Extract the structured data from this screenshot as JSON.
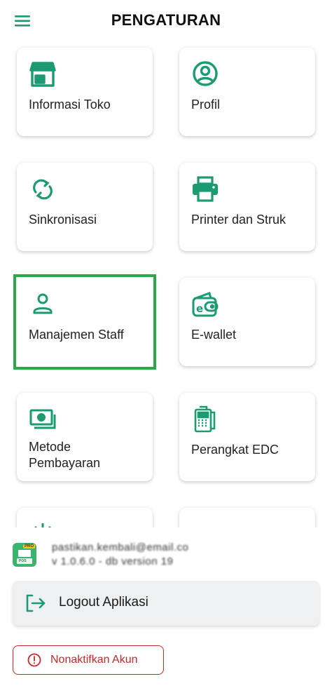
{
  "header": {
    "title": "PENGATURAN",
    "menu_icon": "hamburger-menu-icon"
  },
  "colors": {
    "accent": "#1a9b72",
    "selected_outline": "#2aa84a",
    "danger": "#c62828",
    "logout_bg": "#eef0f2"
  },
  "cards": [
    {
      "label": "Informasi Toko",
      "icon": "store-icon"
    },
    {
      "label": "Profil",
      "icon": "user-circle-icon"
    },
    {
      "label": "Sinkronisasi",
      "icon": "sync-icon"
    },
    {
      "label": "Printer dan Struk",
      "icon": "printer-icon"
    },
    {
      "label": "Manajemen Staff",
      "icon": "staff-icon",
      "selected": true
    },
    {
      "label": "E-wallet",
      "icon": "wallet-icon"
    },
    {
      "label_line1": "Metode",
      "label_line2": "Pembayaran",
      "icon": "payment-method-icon"
    },
    {
      "label": "Perangkat EDC",
      "icon": "edc-device-icon"
    },
    {
      "label": "",
      "icon": "settings-icon"
    },
    {
      "label": "",
      "icon": "partial-icon"
    }
  ],
  "app_info": {
    "line1": "pastikan.kembali@email.co",
    "line2": "v 1.0.6.0 - db version 19",
    "logo_badge": "PRO",
    "logo_text": "POS"
  },
  "logout": {
    "label": "Logout Aplikasi",
    "icon": "logout-icon"
  },
  "deactivate": {
    "label": "Nonaktifkan Akun",
    "icon": "alert-circle-icon"
  }
}
